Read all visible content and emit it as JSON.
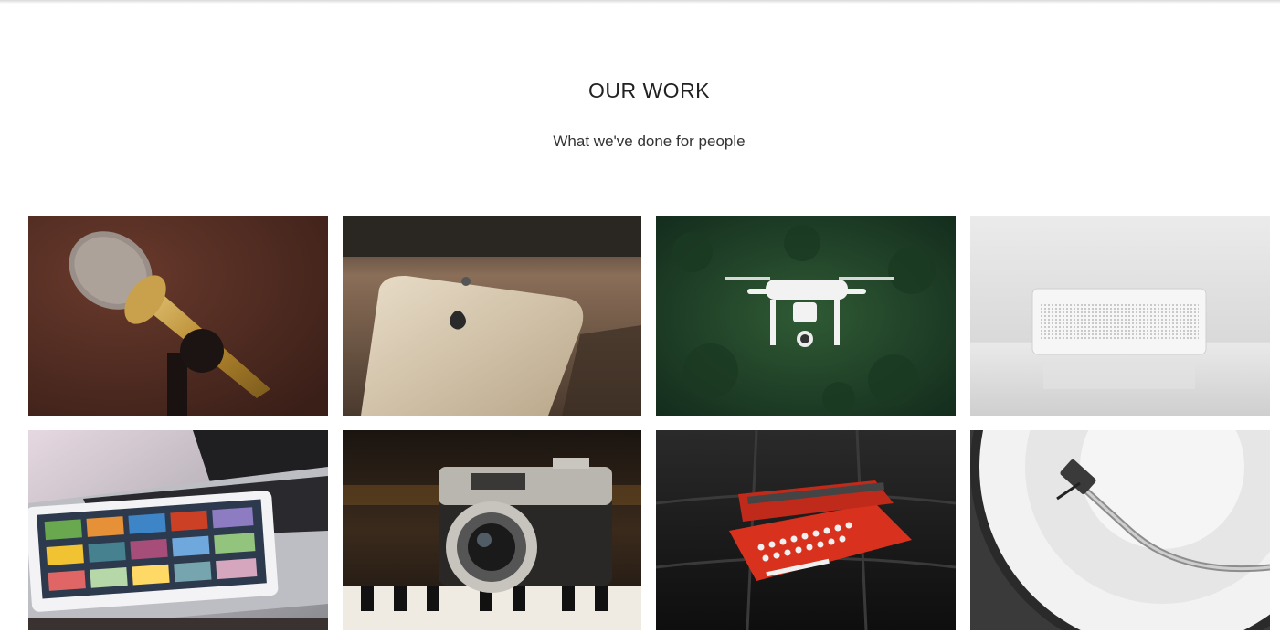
{
  "section": {
    "title": "OUR WORK",
    "subtitle": "What we've done for people"
  },
  "portfolio": {
    "items": [
      {
        "subject": "microphone",
        "background": "#4a2a20"
      },
      {
        "subject": "smartphone",
        "background": "#5c4a3a"
      },
      {
        "subject": "drone",
        "background": "#1f3a22"
      },
      {
        "subject": "speaker",
        "background": "#e4e4e4"
      },
      {
        "subject": "tablet-laptop",
        "background": "#d8d8dc"
      },
      {
        "subject": "camera",
        "background": "#1c1612"
      },
      {
        "subject": "typewriter",
        "background": "#161616"
      },
      {
        "subject": "turntable",
        "background": "#e8e8e8"
      }
    ]
  }
}
